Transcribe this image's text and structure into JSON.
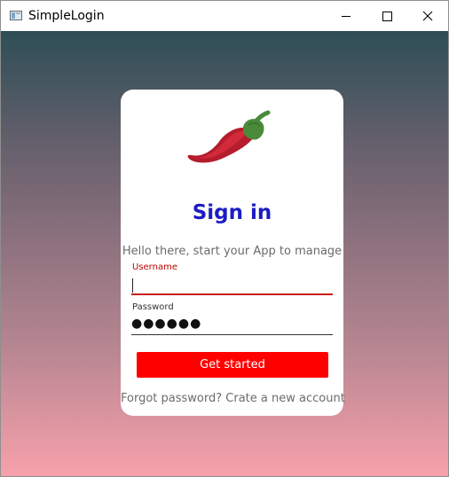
{
  "window": {
    "title": "SimpleLogin",
    "buttons": {
      "minimize_icon": "minimize-icon",
      "maximize_icon": "maximize-icon",
      "close_icon": "close-icon"
    }
  },
  "card": {
    "logo_icon": "chili-pepper-icon",
    "title": "Sign in",
    "subtitle": "Hello there, start your App to manage",
    "username": {
      "label": "Username",
      "value": ""
    },
    "password": {
      "label": "Password",
      "masked_value": "●●●●●●"
    },
    "submit_label": "Get started",
    "forgot_link": "Forgot password?",
    "create_link": "Crate a new account"
  },
  "colors": {
    "title": "#1c1cc4",
    "accent": "#ff0000",
    "username_label": "#c00000",
    "gradient_top": "#2e4e56",
    "gradient_bottom": "#f7a1ab"
  }
}
